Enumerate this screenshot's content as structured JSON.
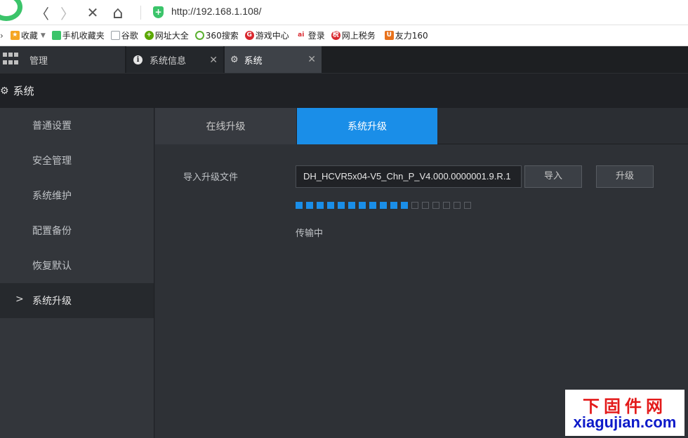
{
  "browser": {
    "url": "http://192.168.1.108/",
    "back_glyph": "〈",
    "forward_glyph": "〉",
    "stop_glyph": "✕",
    "home_glyph": "⌂"
  },
  "bookmarks": [
    {
      "label": "收藏",
      "icon": "star-icon",
      "color": "#f5a623"
    },
    {
      "label": "手机收藏夹",
      "icon": "phone-icon",
      "color": "#3bc46a"
    },
    {
      "label": "谷歌",
      "icon": "page-icon",
      "color": "#9aa0a6"
    },
    {
      "label": "网址大全",
      "icon": "nav-icon",
      "color": "#5aa700"
    },
    {
      "label": "360搜索",
      "icon": "search360-icon",
      "color": "#5bb031"
    },
    {
      "label": "游戏中心",
      "icon": "game-icon",
      "color": "#d9272e"
    },
    {
      "label": "登录",
      "icon": "login-icon",
      "color": "#d9272e"
    },
    {
      "label": "网上税务",
      "icon": "tax-icon",
      "color": "#d9272e"
    },
    {
      "label": "友力160",
      "icon": "ul-icon",
      "color": "#e8721c"
    }
  ],
  "tabs": {
    "manage": "管理",
    "info": "系统信息",
    "system": "系统"
  },
  "section": {
    "title": "系统"
  },
  "sidebar": {
    "items": [
      {
        "label": "普通设置"
      },
      {
        "label": "安全管理"
      },
      {
        "label": "系统维护"
      },
      {
        "label": "配置备份"
      },
      {
        "label": "恢复默认"
      },
      {
        "label": "系统升级"
      }
    ],
    "active_index": 5
  },
  "subtabs": {
    "online": "在线升级",
    "upgrade": "系统升级"
  },
  "upgrade": {
    "import_label": "导入升级文件",
    "file_name": "DH_HCVR5x04-V5_Chn_P_V4.000.0000001.9.R.1",
    "import_button": "导入",
    "upgrade_button": "升级",
    "progress_done": 11,
    "progress_total": 17,
    "status": "传输中"
  },
  "watermark": {
    "cn": "下固件网",
    "en": "xiagujian.com"
  },
  "colors": {
    "accent": "#1a8ee8",
    "brand_green": "#3bc46a"
  }
}
